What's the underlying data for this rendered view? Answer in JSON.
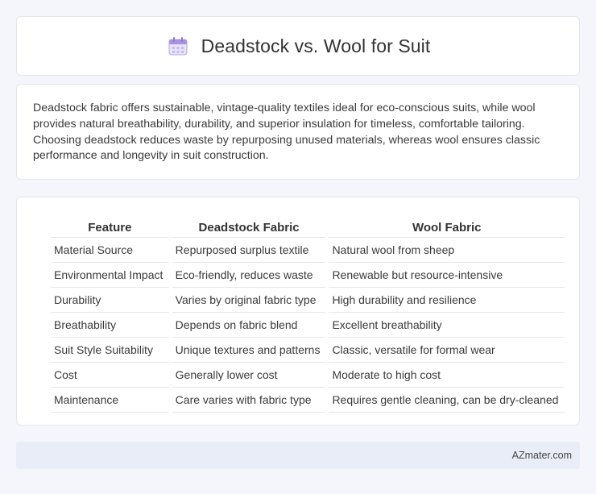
{
  "header": {
    "title": "Deadstock vs. Wool for Suit",
    "icon": "calendar-icon"
  },
  "summary": {
    "text": "Deadstock fabric offers sustainable, vintage-quality textiles ideal for eco-conscious suits, while wool provides natural breathability, durability, and superior insulation for timeless, comfortable tailoring. Choosing deadstock reduces waste by repurposing unused materials, whereas wool ensures classic performance and longevity in suit construction."
  },
  "table": {
    "headers": [
      "Feature",
      "Deadstock Fabric",
      "Wool Fabric"
    ],
    "rows": [
      [
        "Material Source",
        "Repurposed surplus textile",
        "Natural wool from sheep"
      ],
      [
        "Environmental Impact",
        "Eco-friendly, reduces waste",
        "Renewable but resource-intensive"
      ],
      [
        "Durability",
        "Varies by original fabric type",
        "High durability and resilience"
      ],
      [
        "Breathability",
        "Depends on fabric blend",
        "Excellent breathability"
      ],
      [
        "Suit Style Suitability",
        "Unique textures and patterns",
        "Classic, versatile for formal wear"
      ],
      [
        "Cost",
        "Generally lower cost",
        "Moderate to high cost"
      ],
      [
        "Maintenance",
        "Care varies with fabric type",
        "Requires gentle cleaning, can be dry-cleaned"
      ]
    ]
  },
  "footer": {
    "text": "AZmater.com"
  }
}
